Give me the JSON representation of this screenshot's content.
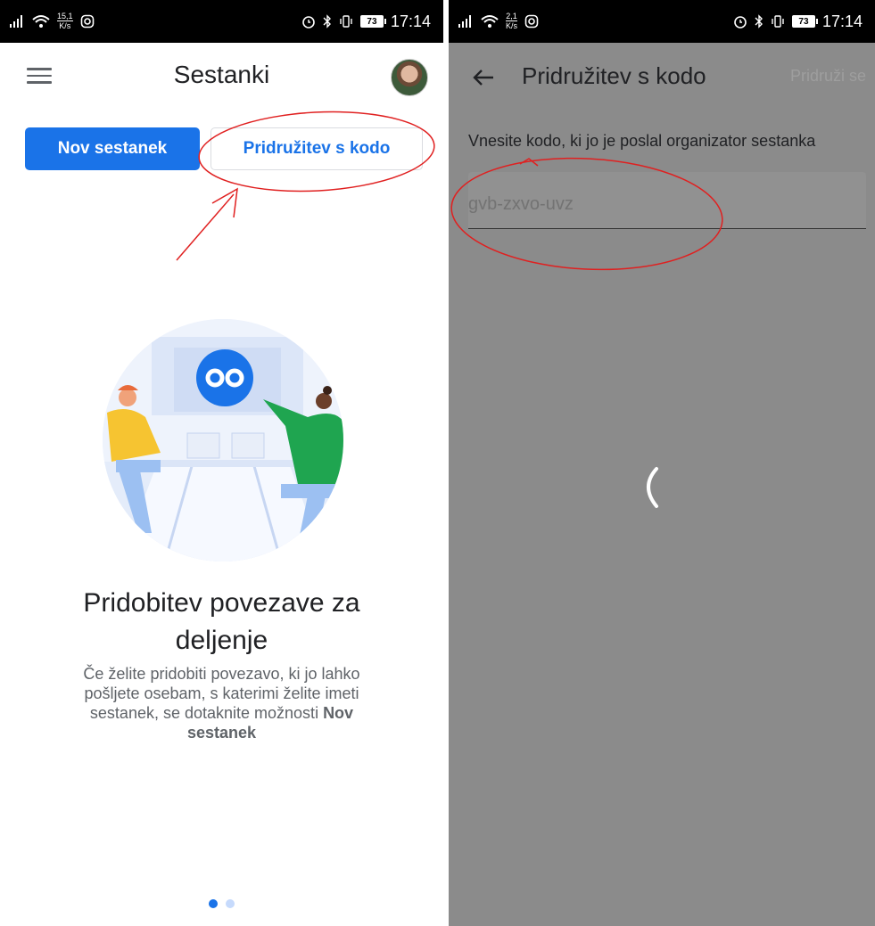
{
  "left_screen": {
    "status": {
      "net_speed_value": "15,1",
      "net_speed_unit": "K/s",
      "battery": "73",
      "time": "17:14"
    },
    "header": {
      "title": "Sestanki"
    },
    "buttons": {
      "new_meeting": "Nov sestanek",
      "join_with_code": "Pridružitev s kodo"
    },
    "promo": {
      "title": "Pridobitev povezave za deljenje",
      "body_prefix": "Če želite pridobiti povezavo, ki jo lahko pošljete osebam, s katerimi želite imeti sestanek, se dotaknite možnosti ",
      "body_bold": "Nov sestanek"
    },
    "pager": {
      "pages": 2,
      "active_index": 0
    }
  },
  "right_screen": {
    "status": {
      "net_speed_value": "2,1",
      "net_speed_unit": "K/s",
      "battery": "73",
      "time": "17:14"
    },
    "header": {
      "title": "Pridružitev s kodo",
      "action": "Pridruži se"
    },
    "instructions": "Vnesite kodo, ki jo je poslal organizator sestanka",
    "code_field": {
      "value": "gvb-zxvo-uvz"
    }
  },
  "colors": {
    "accent": "#1a73e8",
    "overlay_gray": "#8b8b8b",
    "annotation_red": "#e02020"
  }
}
